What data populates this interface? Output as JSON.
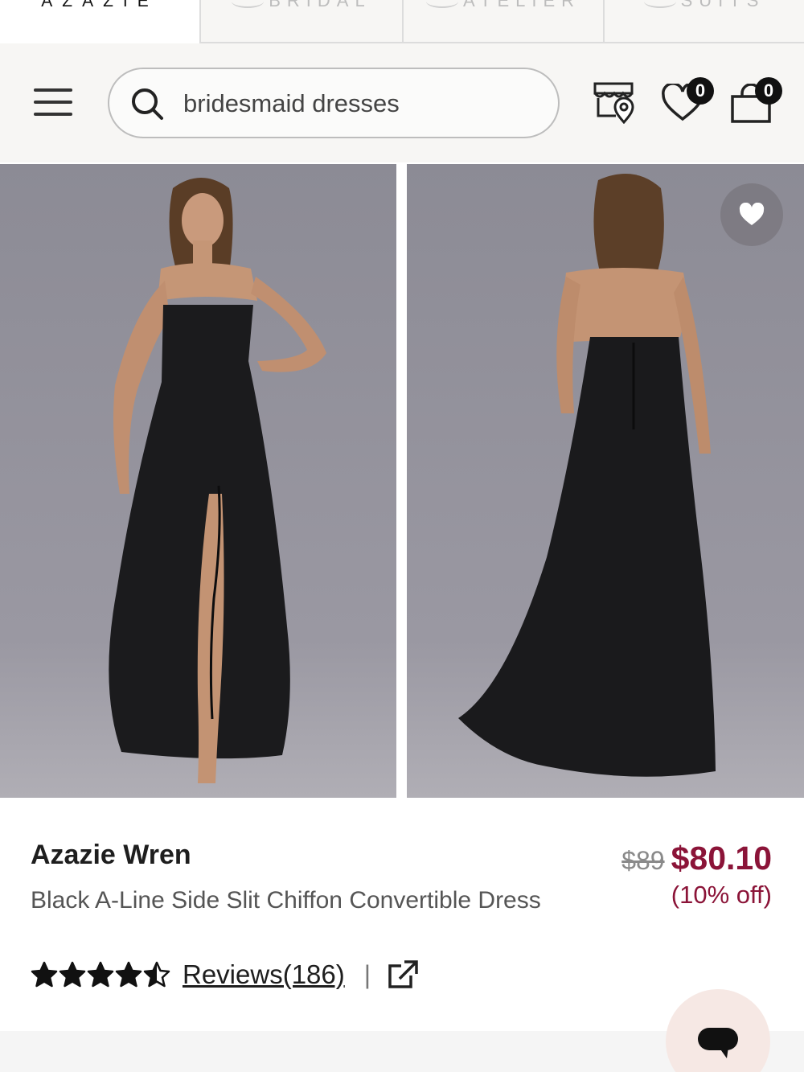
{
  "brand_tabs": [
    {
      "label": "AZAZIE",
      "active": true
    },
    {
      "label": "BRIDAL",
      "active": false
    },
    {
      "label": "ATELIER",
      "active": false
    },
    {
      "label": "SUITS",
      "active": false
    }
  ],
  "header": {
    "search_value": "bridesmaid dresses",
    "wishlist_count": "0",
    "cart_count": "0",
    "icons": [
      "menu-icon",
      "search-icon",
      "store-locator-icon",
      "heart-icon",
      "shopping-bag-icon"
    ]
  },
  "gallery": {
    "images": [
      "front-view",
      "back-view"
    ],
    "favorite_icon": "heart-icon"
  },
  "product": {
    "brand": "Azazie Wren",
    "description": "Black A-Line Side Slit Chiffon Convertible Dress",
    "original_price": "$89",
    "sale_price": "$80.10",
    "discount": "(10% off)",
    "rating": 4.5,
    "rating_max": 5,
    "reviews_label": "Reviews(186)",
    "separator": "|",
    "share_icon": "external-link-icon"
  },
  "colors": {
    "sale": "#8b1438",
    "header_bg": "#f7f6f4",
    "photo_bg": "#8f8e98",
    "chat_bg": "#f6e8e4"
  },
  "chat": {
    "icon": "chat-icon"
  }
}
